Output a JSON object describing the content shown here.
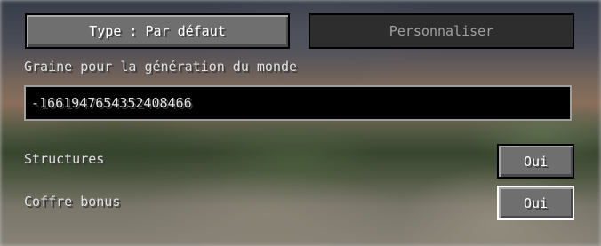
{
  "world_options": {
    "type_button": "Type : Par défaut",
    "customize_button": "Personnaliser",
    "seed_label": "Graine pour la génération du monde",
    "seed_value": "-1661947654352408466",
    "structures_label": "Structures",
    "structures_value": "Oui",
    "bonus_chest_label": "Coffre bonus",
    "bonus_chest_value": "Oui"
  }
}
